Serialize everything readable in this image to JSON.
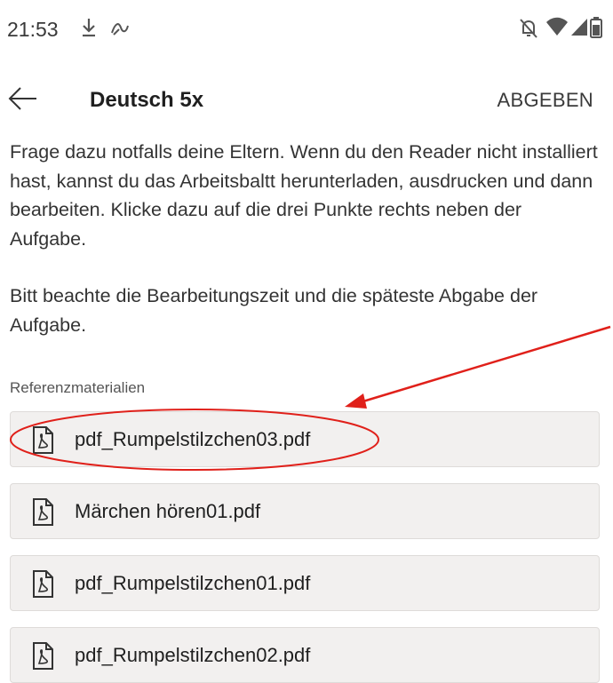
{
  "status_bar": {
    "time": "21:53",
    "icons": [
      "download-icon",
      "link-icon",
      "muted-bell-icon",
      "wifi-icon",
      "signal-icon",
      "battery-icon"
    ]
  },
  "header": {
    "title": "Deutsch 5x",
    "submit_label": "ABGEBEN"
  },
  "instructions": {
    "paragraph1": "Frage dazu notfalls deine  Eltern. Wenn du den Reader nicht installiert hast, kannst du das Arbeitsbaltt herunterladen, ausdrucken und dann bearbeiten. Klicke dazu auf die drei Punkte rechts neben der Aufgabe.",
    "paragraph2": "Bitt beachte die Bearbeitungszeit und die späteste Abgabe der Aufgabe."
  },
  "reference_materials": {
    "label": "Referenzmaterialien",
    "files": [
      {
        "name": "pdf_Rumpelstilzchen03.pdf",
        "icon": "pdf-file-icon"
      },
      {
        "name": "Märchen hören01.pdf",
        "icon": "pdf-file-icon"
      },
      {
        "name": "pdf_Rumpelstilzchen01.pdf",
        "icon": "pdf-file-icon"
      },
      {
        "name": "pdf_Rumpelstilzchen02.pdf",
        "icon": "pdf-file-icon"
      }
    ]
  },
  "annotation": {
    "color": "#e0201a",
    "target": "pdf_Rumpelstilzchen03.pdf"
  }
}
